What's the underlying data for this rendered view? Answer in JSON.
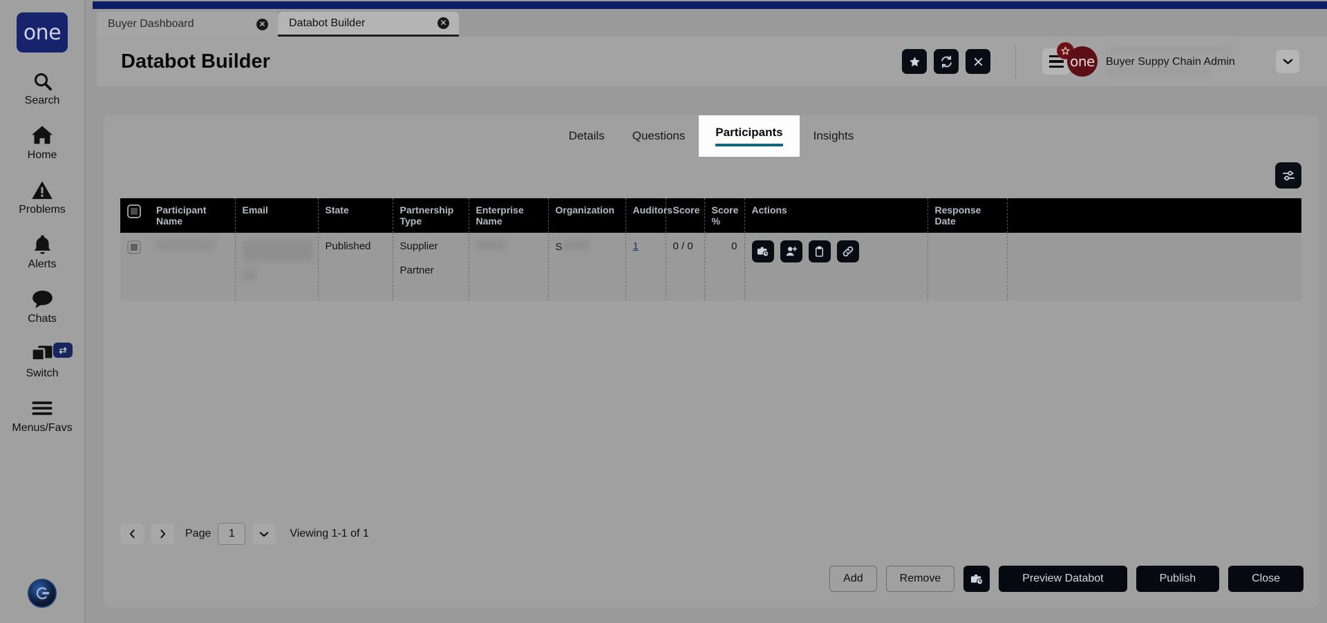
{
  "browser_tabs": [
    {
      "label": "Buyer Dashboard",
      "active": false,
      "close_icon": "close-circle-icon"
    },
    {
      "label": "Databot Builder",
      "active": true,
      "close_icon": "close-circle-icon"
    }
  ],
  "sidebar": {
    "logo": "one",
    "items": [
      {
        "label": "Search",
        "icon": "search-icon"
      },
      {
        "label": "Home",
        "icon": "home-icon"
      },
      {
        "label": "Problems",
        "icon": "warning-triangle-icon"
      },
      {
        "label": "Alerts",
        "icon": "bell-icon"
      },
      {
        "label": "Chats",
        "icon": "chat-bubble-icon"
      },
      {
        "label": "Switch",
        "icon": "windows-stack-icon",
        "badge_icon": "swap-arrows-icon"
      },
      {
        "label": "Menus/Favs",
        "icon": "hamburger-icon"
      }
    ],
    "avatar_icon": "user-avatar-icon"
  },
  "header": {
    "title": "Databot Builder",
    "actions": [
      {
        "name": "favorite-button",
        "icon": "star-icon"
      },
      {
        "name": "refresh-button",
        "icon": "refresh-icon"
      },
      {
        "name": "close-button",
        "icon": "x-icon"
      }
    ],
    "menu_button_icon": "hamburger-icon",
    "menu_badge_icon": "star-icon",
    "brand_circle": "one",
    "user_role": "Buyer Suppy Chain Admin",
    "user_caret_icon": "chevron-down-icon"
  },
  "tabs": [
    {
      "label": "Details",
      "active": false
    },
    {
      "label": "Questions",
      "active": false
    },
    {
      "label": "Participants",
      "active": true
    },
    {
      "label": "Insights",
      "active": false
    }
  ],
  "grid": {
    "settings_icon": "sliders-icon",
    "columns": [
      "",
      "Participant Name",
      "Email",
      "State",
      "Partnership Type",
      "Enterprise Name",
      "Organization",
      "Auditors",
      "Score",
      "Score %",
      "Actions",
      "Response Date",
      ""
    ],
    "rows": [
      {
        "participant_name": "",
        "email": "",
        "state": "Published",
        "partnership_type_1": "Supplier",
        "partnership_type_2": "Partner",
        "enterprise_name": "",
        "organization": "S",
        "auditors": "1",
        "score": "0 / 0",
        "score_pct": "0",
        "response_date": "",
        "actions": [
          {
            "name": "assign-schedule-action",
            "icon": "briefcase-clock-icon"
          },
          {
            "name": "add-participant-action",
            "icon": "person-add-icon"
          },
          {
            "name": "clipboard-action",
            "icon": "clipboard-icon"
          },
          {
            "name": "copy-link-action",
            "icon": "link-icon"
          }
        ]
      }
    ]
  },
  "pagination": {
    "prev_icon": "chevron-left-icon",
    "next_icon": "chevron-right-icon",
    "page_label": "Page",
    "page_value": "1",
    "dropdown_icon": "chevron-down-icon",
    "viewing_text": "Viewing 1-1 of 1"
  },
  "footer": {
    "add": "Add",
    "remove": "Remove",
    "schedule_icon": "briefcase-clock-icon",
    "preview": "Preview Databot",
    "publish": "Publish",
    "close": "Close"
  },
  "colors": {
    "topbar": "#0c1f66",
    "accent_tab_underline": "#11657a",
    "logo_blue": "#17246b",
    "brand_maroon": "#5c0f16",
    "dark_button": "#060a10"
  }
}
